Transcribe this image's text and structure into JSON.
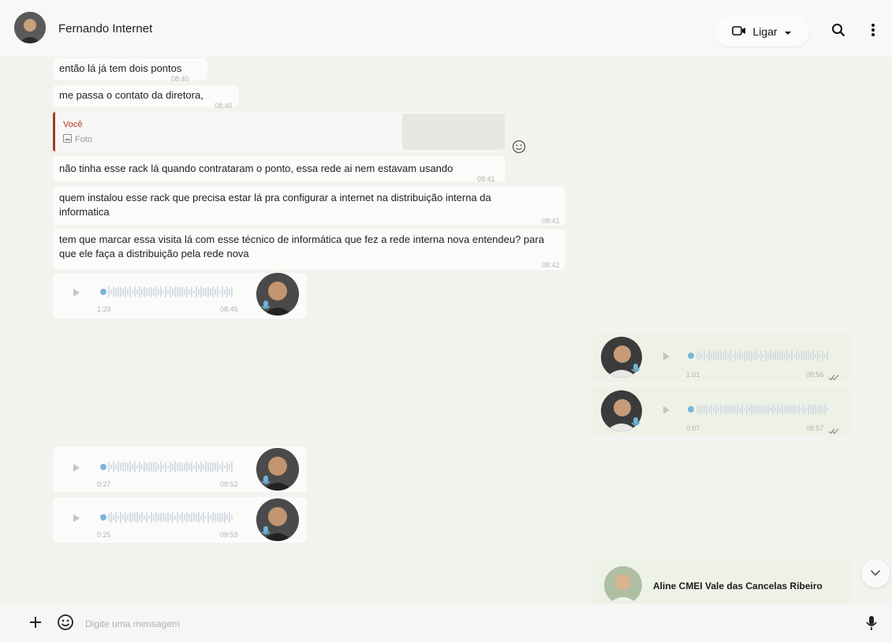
{
  "header": {
    "contact_name": "Fernando Internet",
    "call_label": "Ligar"
  },
  "messages": [
    {
      "text": "então lá já tem dois pontos",
      "time": "08:40"
    },
    {
      "text": "me passa o contato da diretora,",
      "time": "08:40"
    },
    {
      "reply_author": "Você",
      "reply_type": "Foto"
    },
    {
      "text": "não tinha esse rack lá quando contrataram o ponto, essa rede ai nem estavam usando",
      "time": "08:41"
    },
    {
      "text": "quem instalou esse rack que precisa estar lá pra configurar a internet na distribuição interna da informatica",
      "time": "08:41"
    },
    {
      "text": "tem que marcar essa visita lá com esse técnico de informática que fez a rede interna nova entendeu? para que ele faça a distribuição pela rede nova",
      "time": "08:42"
    }
  ],
  "voice_messages": [
    {
      "direction": "in",
      "duration": "1:29",
      "time": "08:45"
    },
    {
      "direction": "out",
      "duration": "1:01",
      "time": "08:56"
    },
    {
      "direction": "out",
      "duration": "0:07",
      "time": "08:57"
    },
    {
      "direction": "in",
      "duration": "0:27",
      "time": "09:52"
    },
    {
      "direction": "in",
      "duration": "0:25",
      "time": "09:53"
    }
  ],
  "forwarded_contact": {
    "name": "Aline CMEI Vale das Cancelas Ribeiro"
  },
  "composer": {
    "placeholder": "Digite uma mensagem"
  },
  "colors": {
    "incoming_bubble": "#fbfbfa",
    "outgoing_bubble": "#eef2e6",
    "reply_accent": "#a23b2b",
    "voice_dot": "#79b6d8"
  },
  "icons": [
    "video-camera-icon",
    "caret-down-icon",
    "search-icon",
    "more-vertical-icon",
    "smiley-icon",
    "photo-icon",
    "play-icon",
    "mic-icon",
    "double-check-icon",
    "plus-icon",
    "chevron-down-icon"
  ]
}
